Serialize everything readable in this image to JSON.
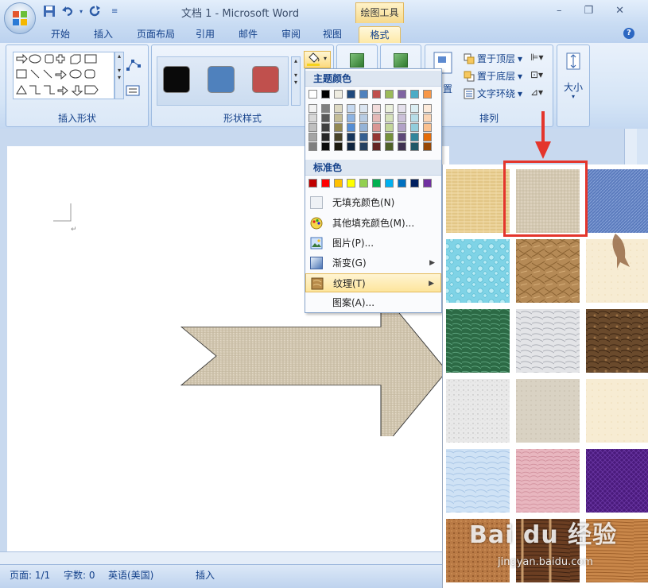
{
  "window": {
    "title": "文档 1 - Microsoft Word",
    "context_tab": "绘图工具",
    "controls": [
      "–",
      "❐",
      "✕"
    ],
    "help": "?"
  },
  "tabs": [
    {
      "label": "开始"
    },
    {
      "label": "插入"
    },
    {
      "label": "页面布局"
    },
    {
      "label": "引用"
    },
    {
      "label": "邮件"
    },
    {
      "label": "审阅"
    },
    {
      "label": "视图"
    },
    {
      "label": "格式"
    }
  ],
  "ribbon": {
    "insert_shapes_label": "插入形状",
    "shape_styles_label": "形状样式",
    "arrange_label": "排列",
    "size_label": "大小",
    "style_swatches": [
      "#0a0a0a",
      "#4f81bd",
      "#c0504d"
    ],
    "arrange_items": [
      "置于顶层",
      "置于底层",
      "文字环绕"
    ],
    "position_label": "置"
  },
  "fill_menu": {
    "theme_header": "主题颜色",
    "standard_header": "标准色",
    "theme_top": [
      "#ffffff",
      "#000000",
      "#eeece1",
      "#1f497d",
      "#4f81bd",
      "#c0504d",
      "#9bbb59",
      "#8064a2",
      "#4bacc6",
      "#f79646"
    ],
    "theme_shades": [
      [
        "#f2f2f2",
        "#808080",
        "#ddd9c3",
        "#c6d9f0",
        "#dbe5f1",
        "#f2dcdb",
        "#ebf1dd",
        "#e5e0ec",
        "#dbeef3",
        "#fdeada"
      ],
      [
        "#d8d8d8",
        "#595959",
        "#c4bd97",
        "#8db3e2",
        "#b8cce4",
        "#e5b9b7",
        "#d7e3bc",
        "#ccc1d9",
        "#b7dde8",
        "#fbd5b5"
      ],
      [
        "#bfbfbf",
        "#3f3f3f",
        "#938953",
        "#548dd4",
        "#95b3d7",
        "#d99694",
        "#c3d69b",
        "#b2a2c7",
        "#92cddc",
        "#fac08f"
      ],
      [
        "#a5a5a5",
        "#262626",
        "#494429",
        "#17365d",
        "#366092",
        "#953734",
        "#76923c",
        "#5f497a",
        "#31859b",
        "#e36c09"
      ],
      [
        "#7f7f7f",
        "#0c0c0c",
        "#1d1b10",
        "#0f243e",
        "#244061",
        "#632423",
        "#4f6128",
        "#3f3151",
        "#205867",
        "#974806"
      ]
    ],
    "standard": [
      "#c00000",
      "#ff0000",
      "#ffc000",
      "#ffff00",
      "#92d050",
      "#00b050",
      "#00b0f0",
      "#0070c0",
      "#002060",
      "#7030a0"
    ],
    "items": [
      {
        "label": "无填充颜色(N)"
      },
      {
        "label": "其他填充颜色(M)..."
      },
      {
        "label": "图片(P)..."
      },
      {
        "label": "渐变(G)"
      },
      {
        "label": "纹理(T)"
      },
      {
        "label": "图案(A)..."
      }
    ]
  },
  "textures": [
    "papyrus",
    "canvas",
    "denim",
    "water-droplets",
    "paper-bag",
    "fish-fossil",
    "green-marble",
    "white-marble",
    "brown-marble",
    "granite",
    "newsprint",
    "recycled-paper",
    "parchment",
    "pink-tissue",
    "purple-mesh",
    "cork",
    "walnut",
    "oak"
  ],
  "status": {
    "page": "页面: 1/1",
    "words": "字数: 0",
    "language": "英语(美国)",
    "mode": "插入"
  },
  "watermark": {
    "brand": "Bai du 经验",
    "url": "jingyan.baidu.com"
  }
}
